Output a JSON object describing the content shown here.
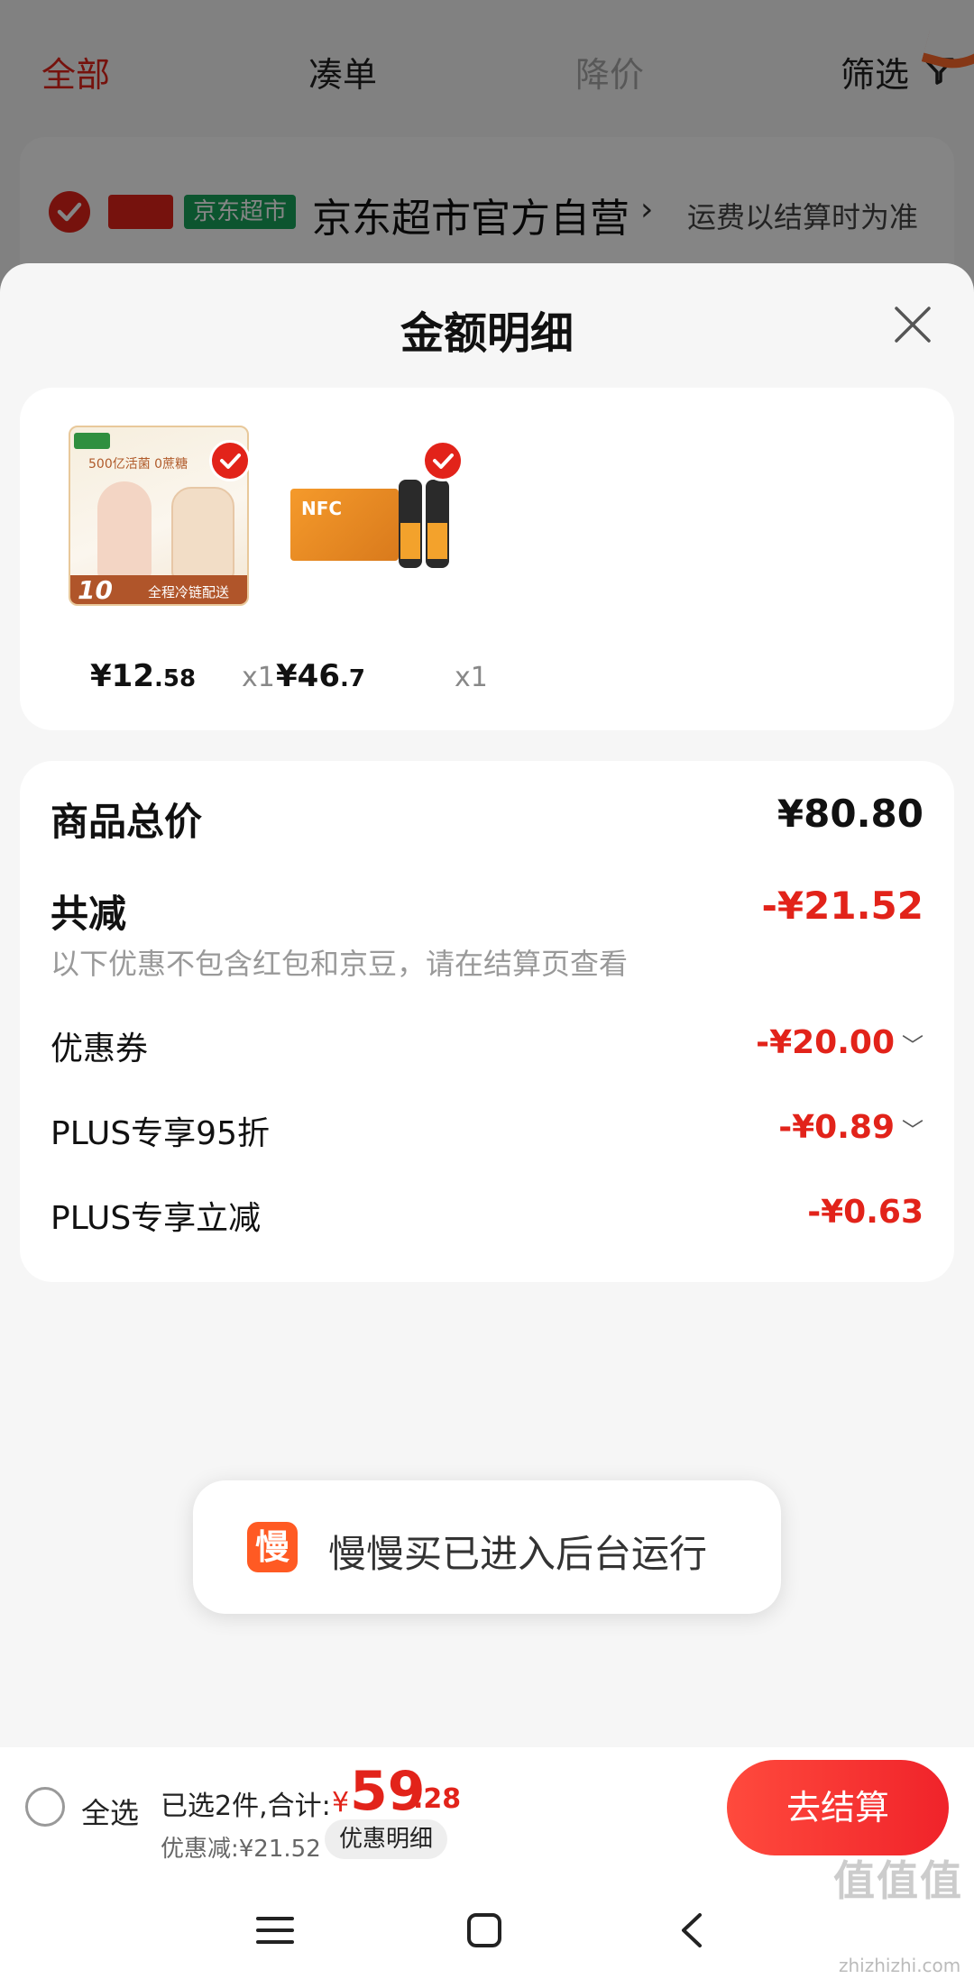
{
  "tabs": [
    {
      "label": "全部",
      "state": "active"
    },
    {
      "label": "凑单",
      "state": "normal"
    },
    {
      "label": "降价",
      "state": "disabled"
    }
  ],
  "filter_label": "筛选",
  "shop": {
    "badge_self": "自营",
    "badge_market": "京东超市",
    "name": "京东超市官方自营",
    "shipping_note": "运费以结算时为准"
  },
  "sheet": {
    "title": "金额明细",
    "products": [
      {
        "price_int": "¥12",
        "price_dec": ".58",
        "qty": "x1",
        "image": "yogurt-drink-image",
        "image_text_top": "500亿活菌 0蔗糖",
        "image_text_bottom": "全程冷链配送",
        "image_badge": "10"
      },
      {
        "price_int": "¥46",
        "price_dec": ".7",
        "qty": "x1",
        "image": "orange-juice-image",
        "image_text": "NFC"
      }
    ],
    "detail": {
      "total_label": "商品总价",
      "total_value": "¥80.80",
      "reduce_label": "共减",
      "reduce_value": "-¥21.52",
      "reduce_note": "以下优惠不包含红包和京豆，请在结算页查看",
      "items": [
        {
          "label": "优惠券",
          "value": "-¥20.00",
          "expandable": true
        },
        {
          "label": "PLUS专享95折",
          "value": "-¥0.89",
          "expandable": true
        },
        {
          "label": "PLUS专享立减",
          "value": "-¥0.63",
          "expandable": false
        }
      ]
    }
  },
  "toast": {
    "logo_char": "慢",
    "text": "慢慢买已进入后台运行"
  },
  "bottom": {
    "select_all": "全选",
    "selected": "已选2件,合计:",
    "currency": "¥",
    "total_int": "59",
    "total_dec": ".28",
    "discount": "优惠减:¥21.52",
    "detail_button": "优惠明细",
    "checkout": "去结算"
  },
  "watermark": {
    "text": "值值值",
    "sub": "zhizhizhi.com"
  },
  "colors": {
    "accent": "#e2231a",
    "green": "#17a35a",
    "toast_logo": "#ff5a23"
  }
}
